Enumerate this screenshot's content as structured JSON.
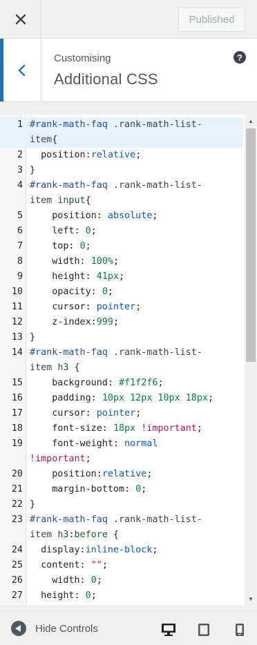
{
  "header": {
    "close_icon": "close-icon",
    "published_label": "Published"
  },
  "section": {
    "breadcrumb": "Customising",
    "title": "Additional CSS",
    "help_icon": "help-icon",
    "help_glyph": "?"
  },
  "editor": {
    "active_line": 1,
    "lines": [
      {
        "n": "1",
        "tokens": [
          [
            "sel",
            "#rank-math-faq"
          ],
          [
            "pl",
            " "
          ],
          [
            "cls",
            ".rank-math-list-"
          ]
        ]
      },
      {
        "n": "",
        "tokens": [
          [
            "cls",
            "item"
          ],
          [
            "pl",
            "{"
          ]
        ]
      },
      {
        "n": "2",
        "tokens": [
          [
            "pl",
            "  position:"
          ],
          [
            "val",
            "relative"
          ],
          [
            "pl",
            ";"
          ]
        ]
      },
      {
        "n": "3",
        "tokens": [
          [
            "pl",
            "}"
          ]
        ]
      },
      {
        "n": "4",
        "tokens": [
          [
            "sel",
            "#rank-math-faq"
          ],
          [
            "pl",
            " "
          ],
          [
            "cls",
            ".rank-math-list-"
          ]
        ]
      },
      {
        "n": "",
        "tokens": [
          [
            "cls",
            "item"
          ],
          [
            "pl",
            " "
          ],
          [
            "tag",
            "input"
          ],
          [
            "pl",
            "{"
          ]
        ]
      },
      {
        "n": "5",
        "tokens": [
          [
            "pl",
            "    position: "
          ],
          [
            "val",
            "absolute"
          ],
          [
            "pl",
            ";"
          ]
        ]
      },
      {
        "n": "6",
        "tokens": [
          [
            "pl",
            "    left: "
          ],
          [
            "num",
            "0"
          ],
          [
            "pl",
            ";"
          ]
        ]
      },
      {
        "n": "7",
        "tokens": [
          [
            "pl",
            "    top: "
          ],
          [
            "num",
            "0"
          ],
          [
            "pl",
            ";"
          ]
        ]
      },
      {
        "n": "8",
        "tokens": [
          [
            "pl",
            "    width: "
          ],
          [
            "num",
            "100%"
          ],
          [
            "pl",
            ";"
          ]
        ]
      },
      {
        "n": "9",
        "tokens": [
          [
            "pl",
            "    height: "
          ],
          [
            "num",
            "41px"
          ],
          [
            "pl",
            ";"
          ]
        ]
      },
      {
        "n": "10",
        "tokens": [
          [
            "pl",
            "    opacity: "
          ],
          [
            "num",
            "0"
          ],
          [
            "pl",
            ";"
          ]
        ]
      },
      {
        "n": "11",
        "tokens": [
          [
            "pl",
            "    cursor: "
          ],
          [
            "val",
            "pointer"
          ],
          [
            "pl",
            ";"
          ]
        ]
      },
      {
        "n": "12",
        "tokens": [
          [
            "pl",
            "    z-index:"
          ],
          [
            "num",
            "999"
          ],
          [
            "pl",
            ";"
          ]
        ]
      },
      {
        "n": "13",
        "tokens": [
          [
            "pl",
            "}"
          ]
        ]
      },
      {
        "n": "14",
        "tokens": [
          [
            "sel",
            "#rank-math-faq"
          ],
          [
            "pl",
            " "
          ],
          [
            "cls",
            ".rank-math-list-"
          ]
        ]
      },
      {
        "n": "",
        "tokens": [
          [
            "cls",
            "item"
          ],
          [
            "pl",
            " "
          ],
          [
            "tag",
            "h3"
          ],
          [
            "pl",
            " {"
          ]
        ]
      },
      {
        "n": "15",
        "tokens": [
          [
            "pl",
            "    background: "
          ],
          [
            "col",
            "#f1f2f6"
          ],
          [
            "pl",
            ";"
          ]
        ]
      },
      {
        "n": "16",
        "tokens": [
          [
            "pl",
            "    padding: "
          ],
          [
            "num",
            "10px 12px 10px 18px"
          ],
          [
            "pl",
            ";"
          ]
        ]
      },
      {
        "n": "17",
        "tokens": [
          [
            "pl",
            "    cursor: "
          ],
          [
            "val",
            "pointer"
          ],
          [
            "pl",
            ";"
          ]
        ]
      },
      {
        "n": "18",
        "tokens": [
          [
            "pl",
            "    font-size: "
          ],
          [
            "num",
            "18px"
          ],
          [
            "pl",
            " "
          ],
          [
            "imp",
            "!important"
          ],
          [
            "pl",
            ";"
          ]
        ]
      },
      {
        "n": "19",
        "tokens": [
          [
            "pl",
            "    font-weight: "
          ],
          [
            "val",
            "normal"
          ]
        ]
      },
      {
        "n": "",
        "tokens": [
          [
            "imp",
            "!important"
          ],
          [
            "pl",
            ";"
          ]
        ]
      },
      {
        "n": "20",
        "tokens": [
          [
            "pl",
            "    position:"
          ],
          [
            "val",
            "relative"
          ],
          [
            "pl",
            ";"
          ]
        ]
      },
      {
        "n": "21",
        "tokens": [
          [
            "pl",
            "    margin-bottom: "
          ],
          [
            "num",
            "0"
          ],
          [
            "pl",
            ";"
          ]
        ]
      },
      {
        "n": "22",
        "tokens": [
          [
            "pl",
            "}"
          ]
        ]
      },
      {
        "n": "23",
        "tokens": [
          [
            "sel",
            "#rank-math-faq"
          ],
          [
            "pl",
            " "
          ],
          [
            "cls",
            ".rank-math-list-"
          ]
        ]
      },
      {
        "n": "",
        "tokens": [
          [
            "cls",
            "item"
          ],
          [
            "pl",
            " "
          ],
          [
            "tag",
            "h3"
          ],
          [
            "pl",
            ":"
          ],
          [
            "tag",
            "before"
          ],
          [
            "pl",
            " {"
          ]
        ]
      },
      {
        "n": "24",
        "tokens": [
          [
            "pl",
            "  display:"
          ],
          [
            "val",
            "inline-block"
          ],
          [
            "pl",
            ";"
          ]
        ]
      },
      {
        "n": "25",
        "tokens": [
          [
            "pl",
            "  content: "
          ],
          [
            "str",
            "\"\""
          ],
          [
            "pl",
            ";"
          ]
        ]
      },
      {
        "n": "26",
        "tokens": [
          [
            "pl",
            "    width: "
          ],
          [
            "num",
            "0"
          ],
          [
            "pl",
            ";"
          ]
        ]
      },
      {
        "n": "27",
        "tokens": [
          [
            "pl",
            "  height: "
          ],
          [
            "num",
            "0"
          ],
          [
            "pl",
            ";"
          ]
        ]
      }
    ]
  },
  "footer": {
    "hide_controls_label": "Hide Controls",
    "hide_controls_icon": "arrow-left-circle-icon",
    "devices": [
      "desktop-icon",
      "tablet-icon",
      "mobile-icon"
    ],
    "active_device": "desktop-icon"
  },
  "colors": {
    "accent": "#2271b1",
    "active_line": "#e8f2ff"
  }
}
